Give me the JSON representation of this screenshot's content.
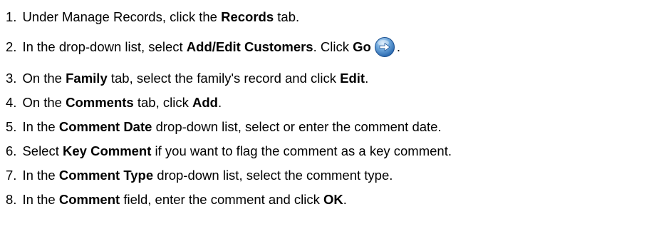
{
  "steps": [
    {
      "number": "1.",
      "parts": [
        {
          "text": "Under Manage Records, click the ",
          "bold": false
        },
        {
          "text": "Records",
          "bold": true
        },
        {
          "text": " tab.",
          "bold": false
        }
      ]
    },
    {
      "number": "2.",
      "parts": [
        {
          "text": "In the drop-down list, select ",
          "bold": false
        },
        {
          "text": "Add/Edit Customers",
          "bold": true
        },
        {
          "text": ". Click ",
          "bold": false
        },
        {
          "text": "Go",
          "bold": true
        },
        {
          "text": ".",
          "bold": false
        }
      ],
      "icon": "go-arrow-icon"
    },
    {
      "number": "3.",
      "parts": [
        {
          "text": "On the ",
          "bold": false
        },
        {
          "text": "Family",
          "bold": true
        },
        {
          "text": " tab, select the family's record and click ",
          "bold": false
        },
        {
          "text": "Edit",
          "bold": true
        },
        {
          "text": ".",
          "bold": false
        }
      ]
    },
    {
      "number": "4.",
      "parts": [
        {
          "text": "On the ",
          "bold": false
        },
        {
          "text": "Comments",
          "bold": true
        },
        {
          "text": " tab, click ",
          "bold": false
        },
        {
          "text": "Add",
          "bold": true
        },
        {
          "text": ".",
          "bold": false
        }
      ]
    },
    {
      "number": "5.",
      "parts": [
        {
          "text": "In the ",
          "bold": false
        },
        {
          "text": "Comment Date",
          "bold": true
        },
        {
          "text": " drop-down list, select or enter the comment date.",
          "bold": false
        }
      ]
    },
    {
      "number": "6.",
      "parts": [
        {
          "text": "Select ",
          "bold": false
        },
        {
          "text": "Key Comment",
          "bold": true
        },
        {
          "text": " if you want to flag the comment as a key comment.",
          "bold": false
        }
      ]
    },
    {
      "number": "7.",
      "parts": [
        {
          "text": "In the ",
          "bold": false
        },
        {
          "text": "Comment Type",
          "bold": true
        },
        {
          "text": " drop-down list, select the comment type.",
          "bold": false
        }
      ]
    },
    {
      "number": "8.",
      "parts": [
        {
          "text": "In the ",
          "bold": false
        },
        {
          "text": "Comment",
          "bold": true
        },
        {
          "text": " field, enter the comment and click ",
          "bold": false
        },
        {
          "text": "OK",
          "bold": true
        },
        {
          "text": ".",
          "bold": false
        }
      ]
    }
  ]
}
